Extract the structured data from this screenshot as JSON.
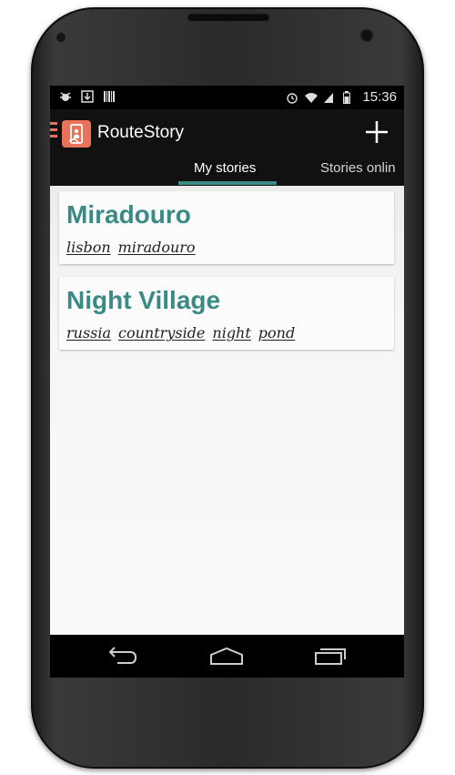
{
  "status_bar": {
    "time": "15:36",
    "left_icons": [
      "debug-icon",
      "download-icon",
      "barcode-icon"
    ],
    "right_icons": [
      "alarm-icon",
      "wifi-icon",
      "signal-icon",
      "battery-icon"
    ]
  },
  "action_bar": {
    "app_title": "RouteStory",
    "add_symbol": "+"
  },
  "tabs": [
    {
      "label": "My stories",
      "selected": true
    },
    {
      "label": "Stories onlin",
      "selected": false
    }
  ],
  "stories": [
    {
      "title": "Miradouro",
      "tags": [
        "lisbon",
        "miradouro"
      ]
    },
    {
      "title": "Night Village",
      "tags": [
        "russia",
        "countryside",
        "night",
        "pond"
      ]
    }
  ],
  "colors": {
    "accent": "#3a8a85",
    "brand": "#e8735a",
    "action_bar": "#111111",
    "content_bg": "#f2f2f2"
  }
}
